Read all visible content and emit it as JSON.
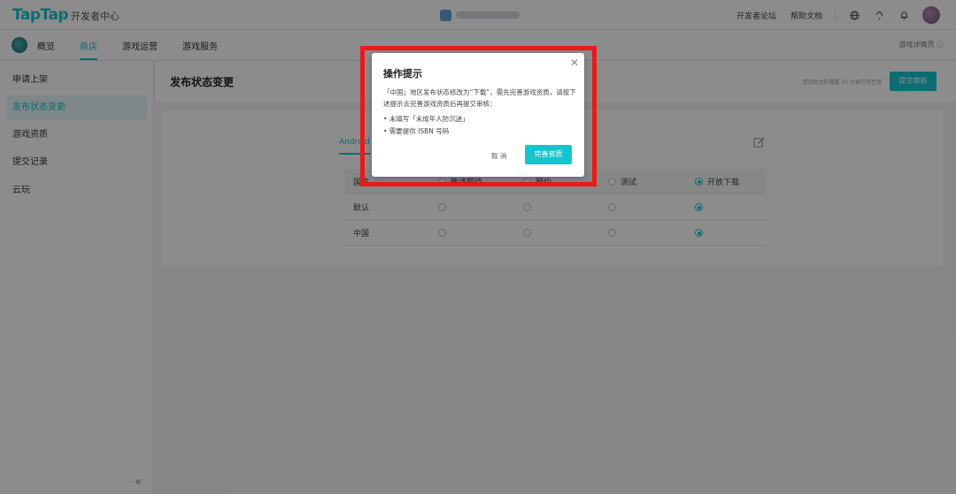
{
  "header": {
    "logo": "TapTap",
    "section": "开发者中心",
    "links": [
      "开发者论坛",
      "帮助文档"
    ]
  },
  "nav": {
    "items": [
      "概览",
      "商店",
      "游戏运营",
      "游戏服务"
    ],
    "active": "商店",
    "right_link": "游戏详情页 ⓘ"
  },
  "sidebar": {
    "items": [
      "申请上架",
      "发布状态变更",
      "游戏资质",
      "提交记录",
      "云玩"
    ],
    "active": "发布状态变更",
    "collapse_glyph": "«"
  },
  "main": {
    "title": "发布状态变更",
    "tip": "提交后大约需要 15 分钟方可生效",
    "submit_label": "提交审核",
    "tab": "Android",
    "table": {
      "headers": [
        "国家",
        "敬请期待",
        "预约",
        "测试",
        "开放下载"
      ],
      "rows": [
        {
          "region": "默认",
          "selected": "开放下载"
        },
        {
          "region": "中国",
          "selected": "开放下载"
        }
      ]
    }
  },
  "dialog": {
    "title": "操作提示",
    "body": "「中国」地区发布状态修改为“下载”，需先完善游戏资质，请按下述提示去完善游戏资质后再提交审核：",
    "bullets": [
      "• 未填写「未成年人防沉迷」",
      "• 需要提供 ISBN 号码"
    ],
    "cancel_label": "取 消",
    "confirm_label": "完善资质",
    "highlight_color": "#e81b1b"
  },
  "colors": {
    "accent": "#15c5ce"
  }
}
